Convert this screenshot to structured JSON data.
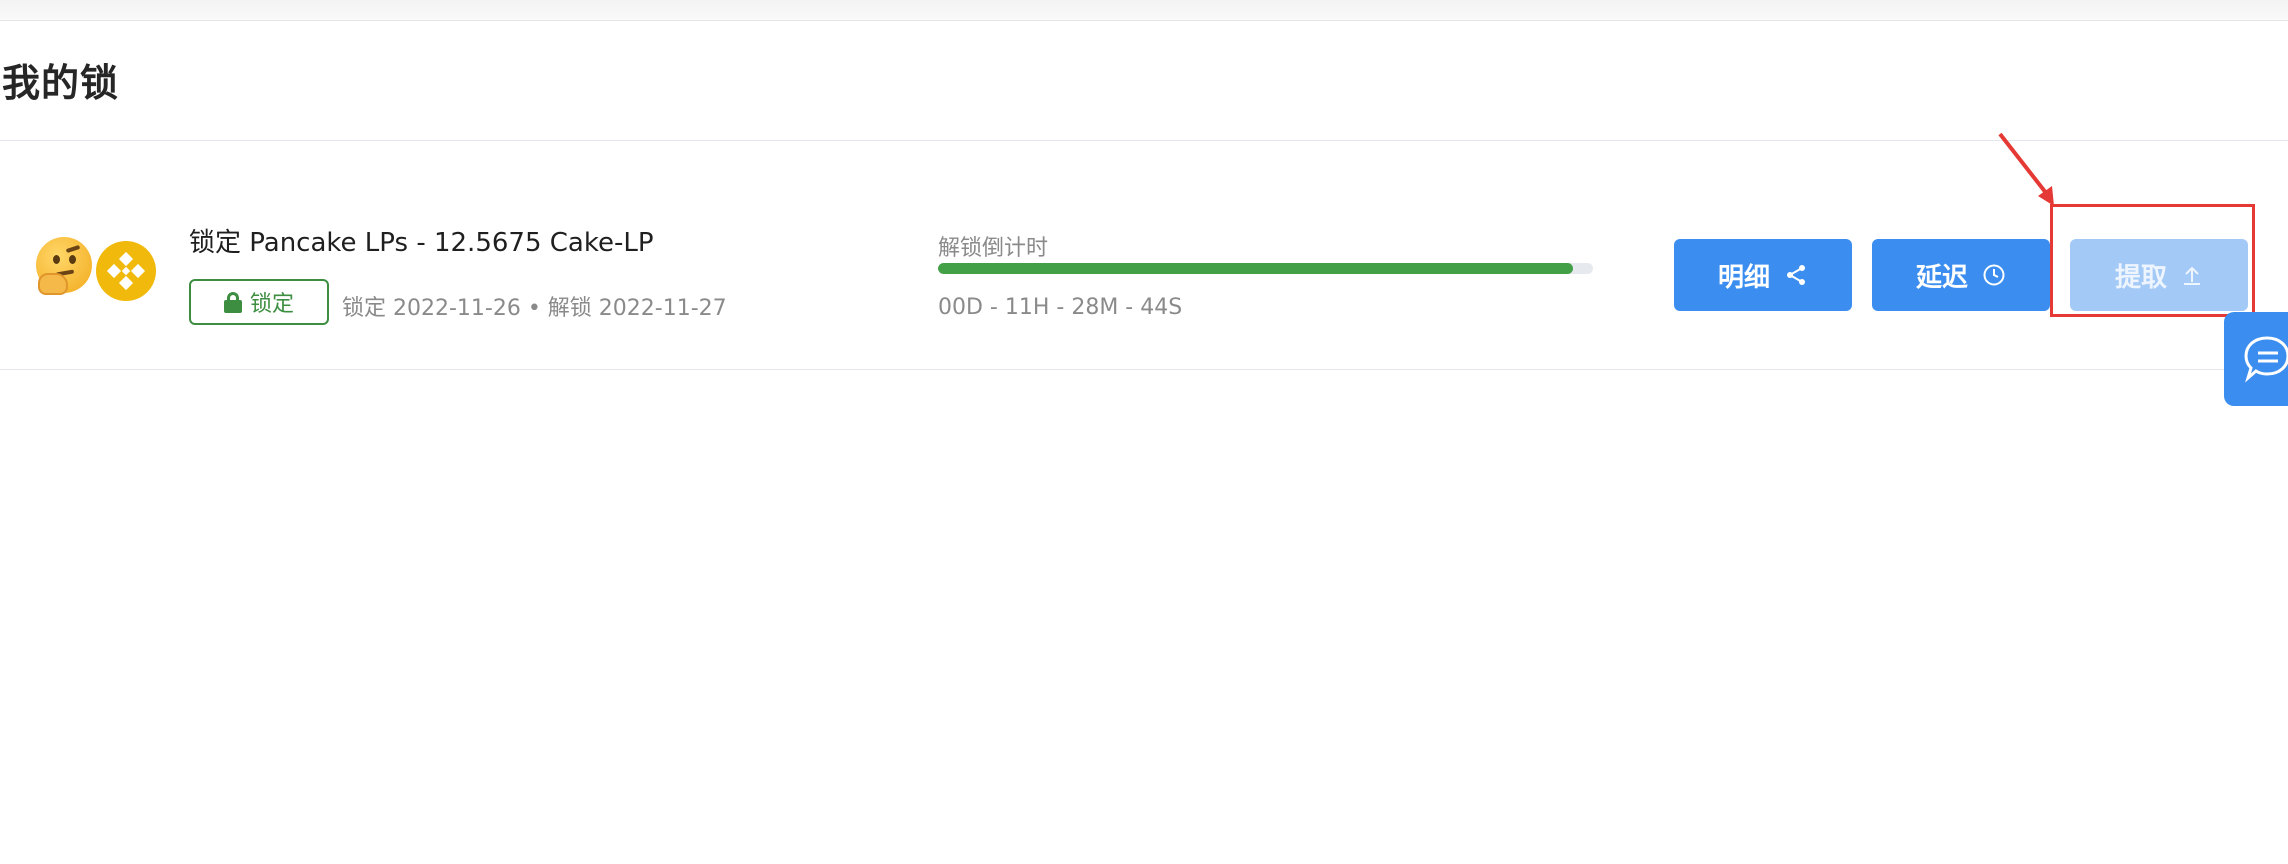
{
  "page": {
    "title": "我的锁"
  },
  "lock_item": {
    "title": "锁定 Pancake LPs - 12.5675 Cake-LP",
    "status_label": "锁定",
    "dates_text": "锁定 2022-11-26 • 解锁 2022-11-27",
    "countdown_label": "解锁倒计时",
    "countdown_value": "00D - 11H - 28M - 44S",
    "progress_fraction": 0.97,
    "progress_color": "#43a047"
  },
  "actions": {
    "detail_label": "明细",
    "delay_label": "延迟",
    "withdraw_label": "提取"
  },
  "icons": {
    "token_icon_1": "thinking-face-emoji",
    "token_icon_2": "bnb-logo",
    "status": "lock-icon",
    "detail": "share-icon",
    "delay": "clock-icon",
    "withdraw": "upload-arrow-icon",
    "chat": "chat-bubble-icon"
  },
  "colors": {
    "primary": "#3b8ef0",
    "disabled": "#a3c9f7",
    "success": "#3e8e41",
    "annotation": "#e53935"
  }
}
